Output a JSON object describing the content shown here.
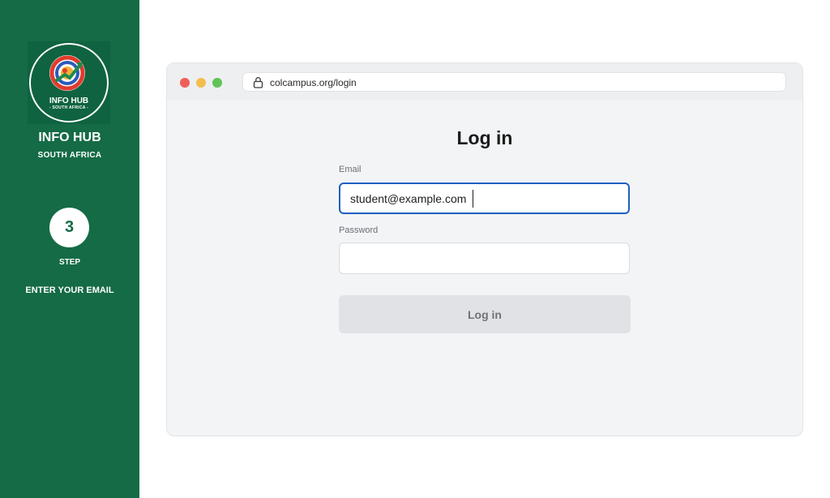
{
  "sidebar": {
    "logo_line1": "INFO HUB",
    "logo_line2": "- SOUTH AFRICA -",
    "brand_title": "INFO HUB",
    "brand_subtitle": "SOUTH AFRICA",
    "step_number": "3",
    "step_label": "STEP",
    "step_description": "ENTER YOUR EMAIL",
    "background_color": "#146b45"
  },
  "browser": {
    "url": "colcampus.org/login",
    "window_controls": [
      "close",
      "minimize",
      "maximize"
    ]
  },
  "login_form": {
    "title": "Log in",
    "email_label": "Email",
    "email_value": "student@example.com",
    "password_label": "Password",
    "password_value": "",
    "submit_label": "Log in",
    "focus_color": "#1f5fbf"
  }
}
